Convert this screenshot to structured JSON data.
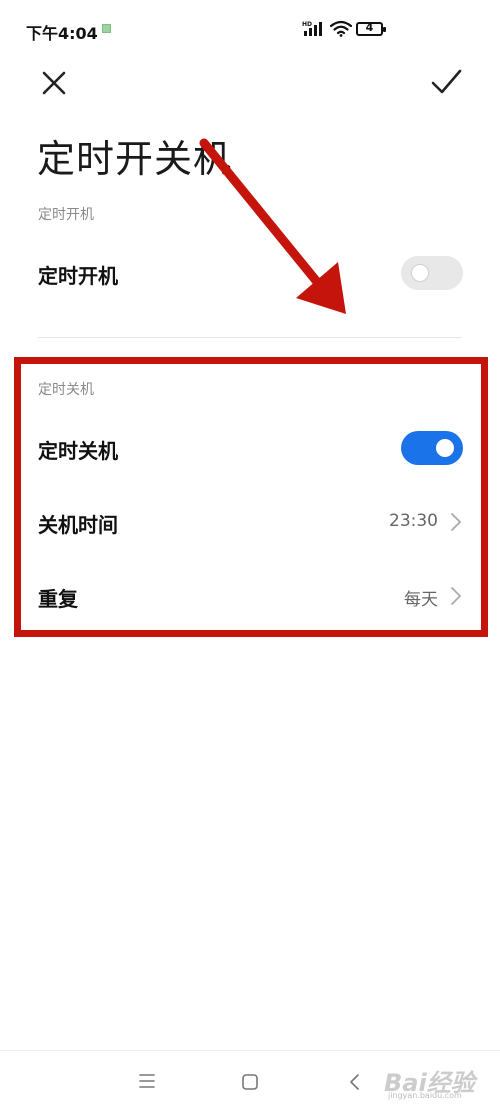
{
  "status_bar": {
    "time": "下午4:04",
    "battery": "4",
    "network_label": "HD"
  },
  "header": {
    "title": "定时开关机"
  },
  "power_on": {
    "section_label": "定时开机",
    "toggle_label": "定时开机",
    "enabled": false
  },
  "power_off": {
    "section_label": "定时关机",
    "toggle_label": "定时关机",
    "enabled": true,
    "time_label": "关机时间",
    "time_value": "23:30",
    "repeat_label": "重复",
    "repeat_value": "每天"
  },
  "watermark": {
    "brand": "Bai经验",
    "url": "jingyan.baidu.com"
  },
  "colors": {
    "accent": "#1a73e8",
    "annotation": "#c4140b"
  }
}
